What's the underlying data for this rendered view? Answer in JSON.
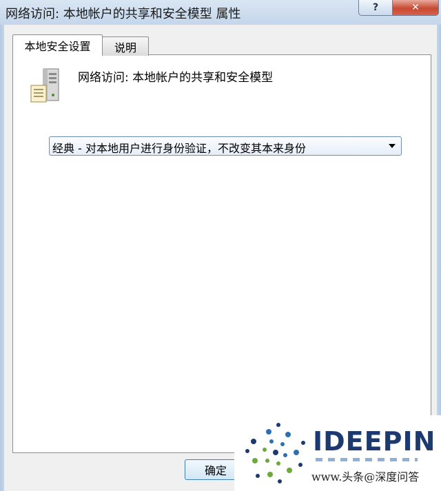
{
  "window": {
    "title": "网络访问: 本地帐户的共享和安全模型 属性",
    "help_label": "?",
    "close_label": "✕"
  },
  "tabs": [
    {
      "label": "本地安全设置",
      "active": true
    },
    {
      "label": "说明",
      "active": false
    }
  ],
  "policy": {
    "icon": "server-icon",
    "title": "网络访问: 本地帐户的共享和安全模型"
  },
  "combo": {
    "selected": "经典 - 对本地用户进行身份验证，不改变其本来身份"
  },
  "buttons": {
    "ok_label": "确定"
  },
  "watermark": {
    "brand": "IDEEPIN",
    "url": "www.头条@深度问答"
  }
}
